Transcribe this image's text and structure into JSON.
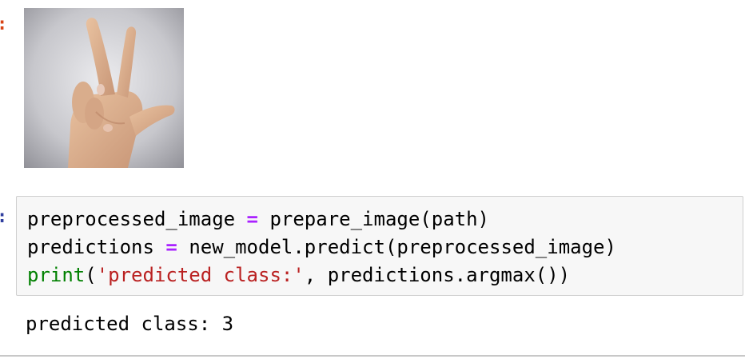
{
  "prompts": {
    "output_prompt_marker": ":",
    "input_prompt_marker": ":"
  },
  "output_image": {
    "alt": "hand showing three fingers",
    "icon": "hand-gesture-image"
  },
  "code_cell": {
    "line1": {
      "lhs": "preprocessed_image",
      "op": "=",
      "rhs": "prepare_image(path)"
    },
    "line2": {
      "lhs": "predictions",
      "op": "=",
      "rhs": "new_model.predict(preprocessed_image)"
    },
    "line3": {
      "func": "print",
      "open": "(",
      "string": "'predicted class:'",
      "rest": ", predictions.argmax())"
    }
  },
  "output": {
    "text": "predicted class: 3"
  },
  "colors": {
    "keyword_green": "#008000",
    "string_red": "#ba2121",
    "operator_purple": "#aa22ff",
    "prompt_orange": "#d84315",
    "prompt_blue": "#303f9f",
    "cell_bg": "#f7f7f7",
    "cell_border": "#cfcfcf"
  }
}
